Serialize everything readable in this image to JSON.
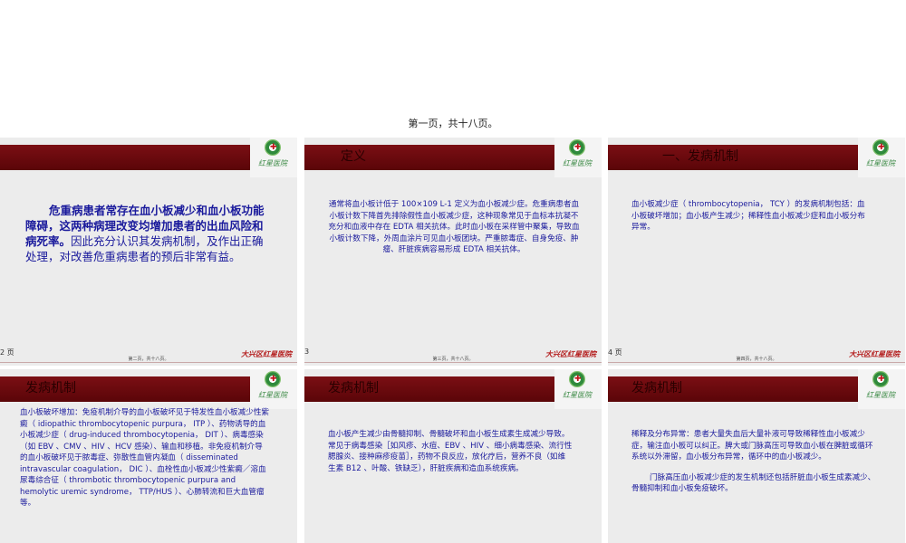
{
  "document": {
    "page_label": "第一页，共十八页。"
  },
  "slides": [
    {
      "title": "",
      "bold_text": "危重病患者常存在血小板减少和血小板功能障碍，这两种病理改变均增加患者的出血风险和病死率。",
      "body": "因此充分认识其发病机制，及作出正确处理，对改善危重病患者的预后非常有益。",
      "page_num": "2 页",
      "footer_mid": "第二页，共十八页。",
      "footer_brand": "大兴区红星医院"
    },
    {
      "title": "定义",
      "body": "通常将血小板计低于 100×109  L-1 定义为血小板减少症。危重病患者血小板计数下降首先排除假性血小板减少症，这种现象常见于血标本抗凝不充分和血液中存在 EDTA 相关抗体。此时血小板在采样管中聚集，导致血小板计数下降，外周血涂片可见血小板团块。严重脓毒症、自身免疫、肿瘤、肝脏疾病容易形成 EDTA 相关抗体。",
      "page_num": "3",
      "footer_mid": "第三页，共十八页。",
      "footer_brand": "大兴区红星医院"
    },
    {
      "title": "一、发病机制",
      "body": "血小板减少症（ thrombocytopenia，  TCY ）的发病机制包括：血小板破坏增加；血小板产生减少；稀释性血小板减少症和血小板分布异常。",
      "page_num": "4 页",
      "footer_mid": "第四页，共十八页。",
      "footer_brand": "大兴区红星医院"
    },
    {
      "title": "发病机制",
      "body": "血小板破坏增加：免疫机制介导的血小板破坏见于特发性血小板减少性紫癜（ idiopathic thrombocytopenic purpura，  ITP ）、药物诱导的血小板减少症（ drug-induced thrombocytopenia，  DIT ）、病毒感染（如 EBV 、CMV 、HIV 、HCV 感染）、输血和移植。非免疫机制介导的血小板破坏见于脓毒症、弥散性血管内凝血（ disseminated intravascular coagulation，  DIC ）、血栓性血小板减少性紫癜／溶血尿毒综合征（ thrombotic thrombocytopenic purpura and hemolytic uremic syndrome，  TTP/HUS ）、心肺转流和巨大血管瘤等。"
    },
    {
      "title": "发病机制",
      "body": "血小板产生减少由骨髓抑制、骨髓破坏和血小板生成素生成减少导致。常见于病毒感染［如风疹、水痘、EBV 、HIV 、细小病毒感染、流行性腮腺炎、接种麻疹疫苗］，药物不良反应，放化疗后，营养不良（如维生素 B12 、叶酸、铁缺乏），肝脏疾病和造血系统疾病。"
    },
    {
      "title": "发病机制",
      "body": "稀释及分布异常：患者大量失血后大量补液可导致稀释性血小板减少症，输注血小板可以纠正。脾大或门脉高压可导致血小板在脾脏或循环系统以外滞留，血小板分布异常，循环中的血小板减少。",
      "body2": "门脉高压血小板减少症的发生机制还包括肝脏血小板生成素减少、骨髓抑制和血小板免疫破坏。"
    }
  ],
  "logo": {
    "brand": "红星医院",
    "icon": "hospital-emblem-icon"
  },
  "colors": {
    "band": "#6a0a0e",
    "body_text": "#1a1a9c",
    "brand_red": "#b41d1d",
    "logo_green": "#2f8a3c"
  }
}
